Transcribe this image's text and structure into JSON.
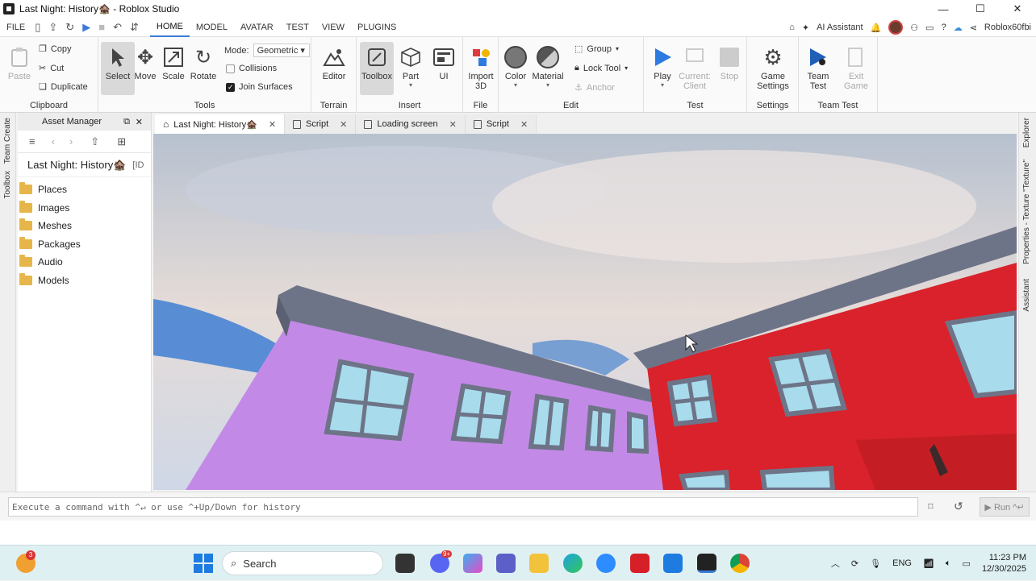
{
  "window": {
    "title": "Last Night: History🏚️ - Roblox Studio",
    "min": "—",
    "max": "☐",
    "close": "✕"
  },
  "menu": {
    "file": "FILE",
    "tabs": [
      "HOME",
      "MODEL",
      "AVATAR",
      "TEST",
      "VIEW",
      "PLUGINS"
    ],
    "ai": "AI Assistant",
    "user": "Roblox60fbi"
  },
  "ribbon": {
    "clipboard": {
      "paste": "Paste",
      "copy": "Copy",
      "cut": "Cut",
      "duplicate": "Duplicate",
      "label": "Clipboard"
    },
    "tools": {
      "select": "Select",
      "move": "Move",
      "scale": "Scale",
      "rotate": "Rotate",
      "mode_label": "Mode:",
      "mode_value": "Geometric",
      "collisions": "Collisions",
      "join": "Join Surfaces",
      "label": "Tools"
    },
    "terrain": {
      "editor": "Editor",
      "label": "Terrain"
    },
    "insert": {
      "toolbox": "Toolbox",
      "part": "Part",
      "ui": "UI",
      "label": "Insert"
    },
    "file": {
      "import1": "Import",
      "import2": "3D",
      "label": "File"
    },
    "edit": {
      "color": "Color",
      "material": "Material",
      "group": "Group",
      "lock": "Lock Tool",
      "anchor": "Anchor",
      "label": "Edit"
    },
    "test": {
      "play": "Play",
      "current1": "Current:",
      "current2": "Client",
      "stop": "Stop",
      "label": "Test"
    },
    "settings": {
      "game1": "Game",
      "game2": "Settings",
      "label": "Settings"
    },
    "teamtest": {
      "team1": "Team",
      "team2": "Test",
      "exit1": "Exit",
      "exit2": "Game",
      "label": "Team Test"
    }
  },
  "left_tabs": {
    "team_create": "Team Create",
    "toolbox": "Toolbox"
  },
  "asset_manager": {
    "title": "Asset Manager",
    "place_name": "Last Night: History🏚️",
    "id_prefix": "[ID",
    "folders": [
      "Places",
      "Images",
      "Meshes",
      "Packages",
      "Audio",
      "Models"
    ]
  },
  "doc_tabs": [
    {
      "label": "Last Night: History🏚️",
      "active": true
    },
    {
      "label": "Script",
      "active": false
    },
    {
      "label": "Loading screen",
      "active": false
    },
    {
      "label": "Script",
      "active": false
    }
  ],
  "right_tabs": {
    "explorer": "Explorer",
    "properties": "Properties - Texture \"Texture\"",
    "assistant": "Assistant"
  },
  "command": {
    "placeholder": "Execute a command with ^↵ or use ^+Up/Down for history",
    "run": "▶ Run ^↵"
  },
  "taskbar": {
    "search": "Search",
    "lang": "ENG",
    "time": "11:23 PM",
    "date": "12/30/2025",
    "badge_weather": "3",
    "badge_discord": "9+"
  },
  "colors": {
    "accent": "#3a7bd5",
    "purple_wall": "#c28ae6",
    "red_wall": "#d9222b",
    "roof": "#6e7488",
    "taskbar": "#dff0f3"
  }
}
